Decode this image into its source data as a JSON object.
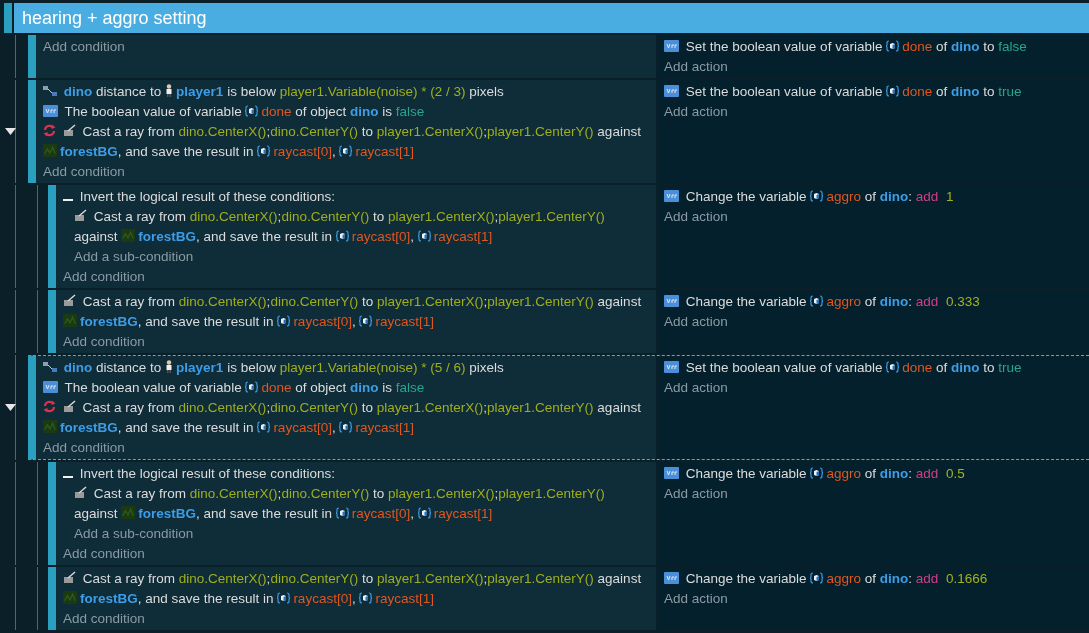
{
  "group": {
    "title": "hearing + aggro setting"
  },
  "events": [
    {
      "selected": false,
      "add_condition": "Add condition",
      "actions": [
        {
          "kind": "variable",
          "segments": [
            {
              "kind": "plain",
              "text": "Set the boolean value of variable"
            },
            {
              "kind": "var",
              "text": "done"
            },
            {
              "kind": "plain",
              "text": "of"
            },
            {
              "kind": "object",
              "text": "dino"
            },
            {
              "kind": "plain",
              "text": "to"
            },
            {
              "kind": "value",
              "text": "false"
            }
          ]
        }
      ],
      "add_action": "Add action"
    },
    {
      "selected": false,
      "expanded": true,
      "conditions": [
        {
          "kind": "distance",
          "inverted": false,
          "segments": [
            {
              "kind": "object",
              "text": "dino"
            },
            {
              "kind": "plain",
              "text": "distance to"
            },
            {
              "kind": "sprite",
              "text": "player1"
            },
            {
              "kind": "plain",
              "text": "is below"
            },
            {
              "kind": "expr",
              "text": "player1.Variable(noise) * (2 / 3)"
            },
            {
              "kind": "plain",
              "text": "pixels"
            }
          ]
        },
        {
          "kind": "boolean",
          "inverted": false,
          "segments": [
            {
              "kind": "plain",
              "text": "The boolean value of variable"
            },
            {
              "kind": "var",
              "text": "done"
            },
            {
              "kind": "plain",
              "text": "of object"
            },
            {
              "kind": "object",
              "text": "dino"
            },
            {
              "kind": "plain",
              "text": "is"
            },
            {
              "kind": "value",
              "text": "false"
            }
          ]
        },
        {
          "kind": "raycast",
          "inverted": true,
          "segments": [
            {
              "kind": "plain",
              "text": "Cast a ray from"
            },
            {
              "kind": "expr",
              "text": "dino.CenterX()"
            },
            {
              "kind": "joiner",
              "text": ";"
            },
            {
              "kind": "expr",
              "text": "dino.CenterY()"
            },
            {
              "kind": "plain",
              "text": "to"
            },
            {
              "kind": "expr",
              "text": "player1.CenterX()"
            },
            {
              "kind": "joiner",
              "text": ";"
            },
            {
              "kind": "expr",
              "text": "player1.CenterY()"
            },
            {
              "kind": "plain",
              "text": "against"
            },
            {
              "kind": "tiled",
              "text": "forestBG"
            },
            {
              "kind": "punct",
              "text": ", and save the result in"
            },
            {
              "kind": "var",
              "text": "raycast[0]"
            },
            {
              "kind": "punct",
              "text": ","
            },
            {
              "kind": "var",
              "text": "raycast[1]"
            }
          ]
        }
      ],
      "add_condition": "Add condition",
      "actions": [
        {
          "kind": "variable",
          "segments": [
            {
              "kind": "plain",
              "text": "Set the boolean value of variable"
            },
            {
              "kind": "var",
              "text": "done"
            },
            {
              "kind": "plain",
              "text": "of"
            },
            {
              "kind": "object",
              "text": "dino"
            },
            {
              "kind": "plain",
              "text": "to"
            },
            {
              "kind": "value",
              "text": "true"
            }
          ]
        }
      ],
      "add_action": "Add action",
      "children": [
        {
          "selected": false,
          "conditions": [
            {
              "kind": "invert-group",
              "text": "Invert the logical result of these conditions:",
              "sub_conditions": [
                {
                  "kind": "raycast",
                  "inverted": false,
                  "segments": [
                    {
                      "kind": "plain",
                      "text": "Cast a ray from"
                    },
                    {
                      "kind": "expr",
                      "text": "dino.CenterX()"
                    },
                    {
                      "kind": "joiner",
                      "text": ";"
                    },
                    {
                      "kind": "expr",
                      "text": "dino.CenterY()"
                    },
                    {
                      "kind": "plain",
                      "text": "to"
                    },
                    {
                      "kind": "expr",
                      "text": "player1.CenterX()"
                    },
                    {
                      "kind": "joiner",
                      "text": ";"
                    },
                    {
                      "kind": "expr",
                      "text": "player1.CenterY()"
                    },
                    {
                      "kind": "plain",
                      "text": "against"
                    },
                    {
                      "kind": "tiled",
                      "text": "forestBG"
                    },
                    {
                      "kind": "punct",
                      "text": ", and save the result in"
                    },
                    {
                      "kind": "var",
                      "text": "raycast[0]"
                    },
                    {
                      "kind": "punct",
                      "text": ","
                    },
                    {
                      "kind": "var",
                      "text": "raycast[1]"
                    }
                  ]
                }
              ],
              "add_sub_condition": "Add a sub-condition"
            }
          ],
          "add_condition": "Add condition",
          "actions": [
            {
              "kind": "variable",
              "segments": [
                {
                  "kind": "plain",
                  "text": "Change the variable"
                },
                {
                  "kind": "var",
                  "text": "aggro"
                },
                {
                  "kind": "plain",
                  "text": "of"
                },
                {
                  "kind": "object",
                  "text": "dino"
                },
                {
                  "kind": "punct",
                  "text": ":"
                },
                {
                  "kind": "op",
                  "text": "add"
                },
                {
                  "kind": "number",
                  "text": "1"
                }
              ]
            }
          ],
          "add_action": "Add action"
        },
        {
          "selected": false,
          "conditions": [
            {
              "kind": "raycast",
              "inverted": false,
              "segments": [
                {
                  "kind": "plain",
                  "text": "Cast a ray from"
                },
                {
                  "kind": "expr",
                  "text": "dino.CenterX()"
                },
                {
                  "kind": "joiner",
                  "text": ";"
                },
                {
                  "kind": "expr",
                  "text": "dino.CenterY()"
                },
                {
                  "kind": "plain",
                  "text": "to"
                },
                {
                  "kind": "expr",
                  "text": "player1.CenterX()"
                },
                {
                  "kind": "joiner",
                  "text": ";"
                },
                {
                  "kind": "expr",
                  "text": "player1.CenterY()"
                },
                {
                  "kind": "plain",
                  "text": "against"
                },
                {
                  "kind": "tiled",
                  "text": "forestBG"
                },
                {
                  "kind": "punct",
                  "text": ", and save the result in"
                },
                {
                  "kind": "var",
                  "text": "raycast[0]"
                },
                {
                  "kind": "punct",
                  "text": ","
                },
                {
                  "kind": "var",
                  "text": "raycast[1]"
                }
              ]
            }
          ],
          "add_condition": "Add condition",
          "actions": [
            {
              "kind": "variable",
              "segments": [
                {
                  "kind": "plain",
                  "text": "Change the variable"
                },
                {
                  "kind": "var",
                  "text": "aggro"
                },
                {
                  "kind": "plain",
                  "text": "of"
                },
                {
                  "kind": "object",
                  "text": "dino"
                },
                {
                  "kind": "punct",
                  "text": ":"
                },
                {
                  "kind": "op",
                  "text": "add"
                },
                {
                  "kind": "number",
                  "text": "0.333"
                }
              ]
            }
          ],
          "add_action": "Add action"
        }
      ]
    },
    {
      "selected": true,
      "expanded": true,
      "conditions": [
        {
          "kind": "distance",
          "inverted": false,
          "segments": [
            {
              "kind": "object",
              "text": "dino"
            },
            {
              "kind": "plain",
              "text": "distance to"
            },
            {
              "kind": "sprite",
              "text": "player1"
            },
            {
              "kind": "plain",
              "text": "is below"
            },
            {
              "kind": "expr",
              "text": "player1.Variable(noise) * (5 / 6)"
            },
            {
              "kind": "plain",
              "text": "pixels"
            }
          ]
        },
        {
          "kind": "boolean",
          "inverted": false,
          "segments": [
            {
              "kind": "plain",
              "text": "The boolean value of variable"
            },
            {
              "kind": "var",
              "text": "done"
            },
            {
              "kind": "plain",
              "text": "of object"
            },
            {
              "kind": "object",
              "text": "dino"
            },
            {
              "kind": "plain",
              "text": "is"
            },
            {
              "kind": "value",
              "text": "false"
            }
          ]
        },
        {
          "kind": "raycast",
          "inverted": true,
          "segments": [
            {
              "kind": "plain",
              "text": "Cast a ray from"
            },
            {
              "kind": "expr",
              "text": "dino.CenterX()"
            },
            {
              "kind": "joiner",
              "text": ";"
            },
            {
              "kind": "expr",
              "text": "dino.CenterY()"
            },
            {
              "kind": "plain",
              "text": "to"
            },
            {
              "kind": "expr",
              "text": "player1.CenterX()"
            },
            {
              "kind": "joiner",
              "text": ";"
            },
            {
              "kind": "expr",
              "text": "player1.CenterY()"
            },
            {
              "kind": "plain",
              "text": "against"
            },
            {
              "kind": "tiled",
              "text": "forestBG"
            },
            {
              "kind": "punct",
              "text": ", and save the result in"
            },
            {
              "kind": "var",
              "text": "raycast[0]"
            },
            {
              "kind": "punct",
              "text": ","
            },
            {
              "kind": "var",
              "text": "raycast[1]"
            }
          ]
        }
      ],
      "add_condition": "Add condition",
      "actions": [
        {
          "kind": "variable",
          "segments": [
            {
              "kind": "plain",
              "text": "Set the boolean value of variable"
            },
            {
              "kind": "var",
              "text": "done"
            },
            {
              "kind": "plain",
              "text": "of"
            },
            {
              "kind": "object",
              "text": "dino"
            },
            {
              "kind": "plain",
              "text": "to"
            },
            {
              "kind": "value",
              "text": "true"
            }
          ]
        }
      ],
      "add_action": "Add action",
      "children": [
        {
          "selected": false,
          "conditions": [
            {
              "kind": "invert-group",
              "text": "Invert the logical result of these conditions:",
              "sub_conditions": [
                {
                  "kind": "raycast",
                  "inverted": false,
                  "segments": [
                    {
                      "kind": "plain",
                      "text": "Cast a ray from"
                    },
                    {
                      "kind": "expr",
                      "text": "dino.CenterX()"
                    },
                    {
                      "kind": "joiner",
                      "text": ";"
                    },
                    {
                      "kind": "expr",
                      "text": "dino.CenterY()"
                    },
                    {
                      "kind": "plain",
                      "text": "to"
                    },
                    {
                      "kind": "expr",
                      "text": "player1.CenterX()"
                    },
                    {
                      "kind": "joiner",
                      "text": ";"
                    },
                    {
                      "kind": "expr",
                      "text": "player1.CenterY()"
                    },
                    {
                      "kind": "plain",
                      "text": "against"
                    },
                    {
                      "kind": "tiled",
                      "text": "forestBG"
                    },
                    {
                      "kind": "punct",
                      "text": ", and save the result in"
                    },
                    {
                      "kind": "var",
                      "text": "raycast[0]"
                    },
                    {
                      "kind": "punct",
                      "text": ","
                    },
                    {
                      "kind": "var",
                      "text": "raycast[1]"
                    }
                  ]
                }
              ],
              "add_sub_condition": "Add a sub-condition"
            }
          ],
          "add_condition": "Add condition",
          "actions": [
            {
              "kind": "variable",
              "segments": [
                {
                  "kind": "plain",
                  "text": "Change the variable"
                },
                {
                  "kind": "var",
                  "text": "aggro"
                },
                {
                  "kind": "plain",
                  "text": "of"
                },
                {
                  "kind": "object",
                  "text": "dino"
                },
                {
                  "kind": "punct",
                  "text": ":"
                },
                {
                  "kind": "op",
                  "text": "add"
                },
                {
                  "kind": "number",
                  "text": "0.5"
                }
              ]
            }
          ],
          "add_action": "Add action"
        },
        {
          "selected": false,
          "conditions": [
            {
              "kind": "raycast",
              "inverted": false,
              "segments": [
                {
                  "kind": "plain",
                  "text": "Cast a ray from"
                },
                {
                  "kind": "expr",
                  "text": "dino.CenterX()"
                },
                {
                  "kind": "joiner",
                  "text": ";"
                },
                {
                  "kind": "expr",
                  "text": "dino.CenterY()"
                },
                {
                  "kind": "plain",
                  "text": "to"
                },
                {
                  "kind": "expr",
                  "text": "player1.CenterX()"
                },
                {
                  "kind": "joiner",
                  "text": ";"
                },
                {
                  "kind": "expr",
                  "text": "player1.CenterY()"
                },
                {
                  "kind": "plain",
                  "text": "against"
                },
                {
                  "kind": "tiled",
                  "text": "forestBG"
                },
                {
                  "kind": "punct",
                  "text": ", and save the result in"
                },
                {
                  "kind": "var",
                  "text": "raycast[0]"
                },
                {
                  "kind": "punct",
                  "text": ","
                },
                {
                  "kind": "var",
                  "text": "raycast[1]"
                }
              ]
            }
          ],
          "add_condition": "Add condition",
          "actions": [
            {
              "kind": "variable",
              "segments": [
                {
                  "kind": "plain",
                  "text": "Change the variable"
                },
                {
                  "kind": "var",
                  "text": "aggro"
                },
                {
                  "kind": "plain",
                  "text": "of"
                },
                {
                  "kind": "object",
                  "text": "dino"
                },
                {
                  "kind": "punct",
                  "text": ":"
                },
                {
                  "kind": "op",
                  "text": "add"
                },
                {
                  "kind": "number",
                  "text": "0.1666"
                }
              ]
            }
          ],
          "add_action": "Add action"
        }
      ]
    }
  ]
}
